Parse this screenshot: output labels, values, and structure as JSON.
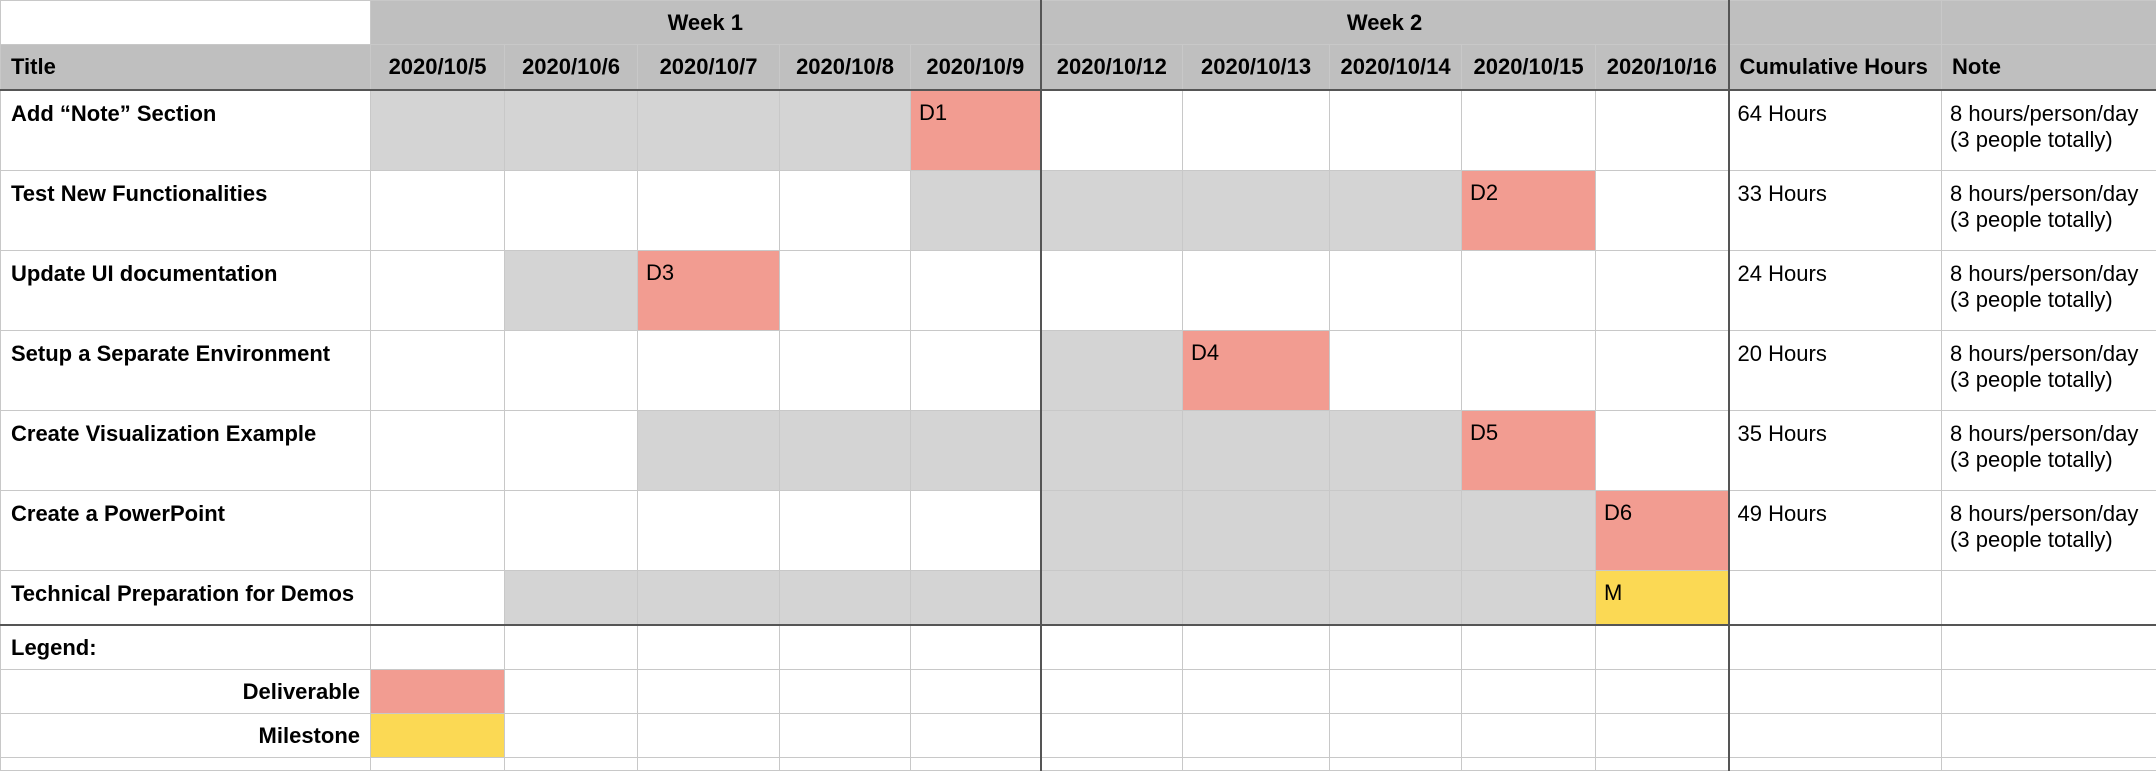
{
  "weeks": [
    "Week 1",
    "Week 2"
  ],
  "header": {
    "title": "Title",
    "dates": [
      "2020/10/5",
      "2020/10/6",
      "2020/10/7",
      "2020/10/8",
      "2020/10/9",
      "2020/10/12",
      "2020/10/13",
      "2020/10/14",
      "2020/10/15",
      "2020/10/16"
    ],
    "cumulative": "Cumulative Hours",
    "note": "Note"
  },
  "colors": {
    "header_bg": "#bfbfbf",
    "in_progress": "#d4d4d4",
    "deliverable": "#f29c91",
    "milestone": "#fbd954"
  },
  "tasks": [
    {
      "title": "Add “Note” Section",
      "cells": [
        "g",
        "g",
        "g",
        "g",
        "D1",
        "",
        "",
        "",
        "",
        ""
      ],
      "hours": "64 Hours",
      "note": "8 hours/person/day (3 people totally)"
    },
    {
      "title": "Test New Functionalities",
      "cells": [
        "",
        "",
        "",
        "",
        "g",
        "g",
        "g",
        "g",
        "D2",
        ""
      ],
      "hours": "33 Hours",
      "note": "8 hours/person/day (3 people totally)"
    },
    {
      "title": "Update UI documentation",
      "cells": [
        "",
        "g",
        "D3",
        "",
        "",
        "",
        "",
        "",
        "",
        ""
      ],
      "hours": "24 Hours",
      "note": "8 hours/person/day (3 people totally)"
    },
    {
      "title": "Setup a Separate Environment",
      "cells": [
        "",
        "",
        "",
        "",
        "",
        "g",
        "D4",
        "",
        "",
        ""
      ],
      "hours": "20 Hours",
      "note": "8 hours/person/day (3 people totally)"
    },
    {
      "title": "Create Visualization Example",
      "cells": [
        "",
        "",
        "g",
        "g",
        "g",
        "g",
        "g",
        "g",
        "D5",
        ""
      ],
      "hours": "35 Hours",
      "note": "8 hours/person/day (3 people totally)"
    },
    {
      "title": "Create a PowerPoint",
      "cells": [
        "",
        "",
        "",
        "",
        "",
        "g",
        "g",
        "g",
        "g",
        "D6"
      ],
      "hours": "49 Hours",
      "note": "8 hours/person/day (3 people totally)"
    },
    {
      "title": "Technical Preparation for Demos",
      "cells": [
        "",
        "g",
        "g",
        "g",
        "g",
        "g",
        "g",
        "g",
        "g",
        "M"
      ],
      "hours": "",
      "note": ""
    }
  ],
  "legend": {
    "title": "Legend:",
    "deliverable": "Deliverable",
    "milestone": "Milestone"
  }
}
